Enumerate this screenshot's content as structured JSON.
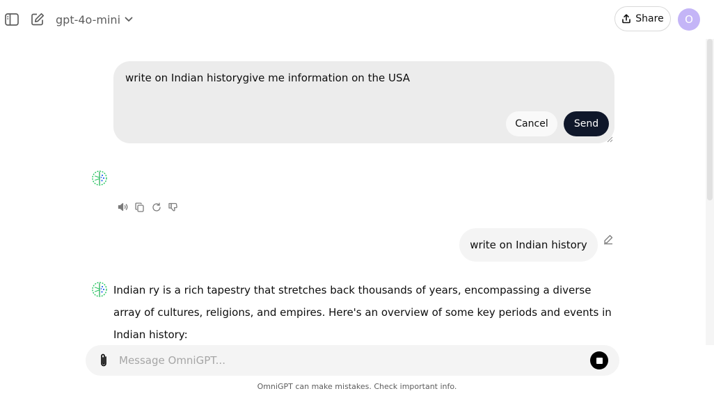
{
  "header": {
    "model_name": "gpt-4o-mini",
    "share_label": "Share",
    "avatar_initial": "O"
  },
  "edit_box": {
    "text": "write on Indian historygive me information on the USA",
    "cancel_label": "Cancel",
    "send_label": "Send"
  },
  "user_message": {
    "text": "write on Indian history"
  },
  "assistant_response": {
    "text": "Indian ry is a rich tapestry that stretches back thousands of years, encompassing a diverse array of cultures, religions, and empires. Here's an overview of some key periods and events in Indian history:"
  },
  "composer": {
    "placeholder": "Message OmniGPT..."
  },
  "footer": {
    "disclaimer": "OmniGPT can make mistakes. Check important info."
  },
  "colors": {
    "send_button": "#0f172a",
    "avatar_bg": "#c4b5f7",
    "bubble_bg": "#f4f4f4",
    "edit_box_bg": "#ececec",
    "bot_icon_green": "#22c55e",
    "bot_icon_blue": "#2563eb"
  }
}
